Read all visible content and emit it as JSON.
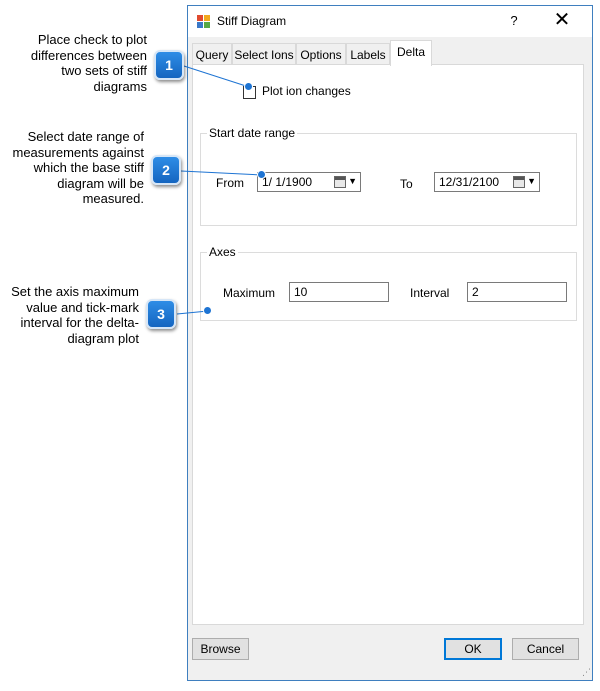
{
  "callouts": [
    {
      "number": "1",
      "text": "Place check to plot differences between two sets of stiff diagrams"
    },
    {
      "number": "2",
      "text": "Select date range of measurements against which the base stiff diagram will be measured."
    },
    {
      "number": "3",
      "text": "Set the axis maximum value and tick-mark interval for the delta-diagram plot"
    }
  ],
  "window": {
    "title": "Stiff Diagram",
    "help_glyph": "?",
    "close_glyph": "✕",
    "icon": "app-chart-icon"
  },
  "tabs": [
    {
      "label": "Query"
    },
    {
      "label": "Select Ions"
    },
    {
      "label": "Options"
    },
    {
      "label": "Labels"
    },
    {
      "label": "Delta"
    }
  ],
  "active_tab": "Delta",
  "delta": {
    "plot_ion_changes_label": "Plot ion changes",
    "plot_ion_changes_checked": false,
    "start_date_range": {
      "title": "Start date range",
      "from_label": "From",
      "from_value": "1/ 1/1900",
      "to_label": "To",
      "to_value": "12/31/2100",
      "dropdown_glyph": "▼"
    },
    "axes": {
      "title": "Axes",
      "maximum_label": "Maximum",
      "maximum_value": "10",
      "interval_label": "Interval",
      "interval_value": "2"
    }
  },
  "footer": {
    "browse_label": "Browse",
    "ok_label": "OK",
    "cancel_label": "Cancel"
  },
  "colors": {
    "callout_accent": "#1e74d3",
    "window_border": "#3f7fbf",
    "default_button_border": "#0078d7"
  }
}
